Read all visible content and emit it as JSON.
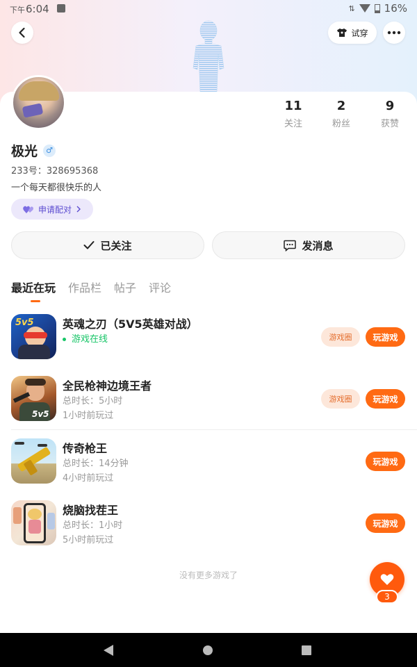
{
  "status_bar": {
    "ampm": "下午",
    "time": "6:04",
    "battery": "16%"
  },
  "header": {
    "tryon_label": "试穿"
  },
  "profile": {
    "name": "极光",
    "gender": "♂",
    "uid_label": "233号：",
    "uid": "328695368",
    "bio": "一个每天都很快乐的人",
    "pair_label": "申请配对",
    "stats": [
      {
        "num": "11",
        "label": "关注"
      },
      {
        "num": "2",
        "label": "粉丝"
      },
      {
        "num": "9",
        "label": "获赞"
      }
    ]
  },
  "actions": {
    "follow_label": "已关注",
    "message_label": "发消息"
  },
  "tabs": [
    "最近在玩",
    "作品栏",
    "帖子",
    "评论"
  ],
  "games": [
    {
      "title": "英魂之刃（5V5英雄对战）",
      "status": "游戏在线",
      "circle_label": "游戏圈",
      "play_label": "玩游戏",
      "icon_text": "5v5"
    },
    {
      "title": "全民枪神边境王者",
      "duration": "总时长：5小时",
      "last": "1小时前玩过",
      "circle_label": "游戏圈",
      "play_label": "玩游戏",
      "icon_text": "5v5"
    },
    {
      "title": "传奇枪王",
      "duration": "总时长：14分钟",
      "last": "4小时前玩过",
      "play_label": "玩游戏"
    },
    {
      "title": "烧脑找茬王",
      "duration": "总时长：1小时",
      "last": "5小时前玩过",
      "play_label": "玩游戏"
    }
  ],
  "footer": {
    "no_more": "没有更多游戏了"
  },
  "fab": {
    "count": "3"
  },
  "colors": {
    "accent": "#ff6a13",
    "online": "#17c567",
    "pair": "#5b4bd0"
  }
}
